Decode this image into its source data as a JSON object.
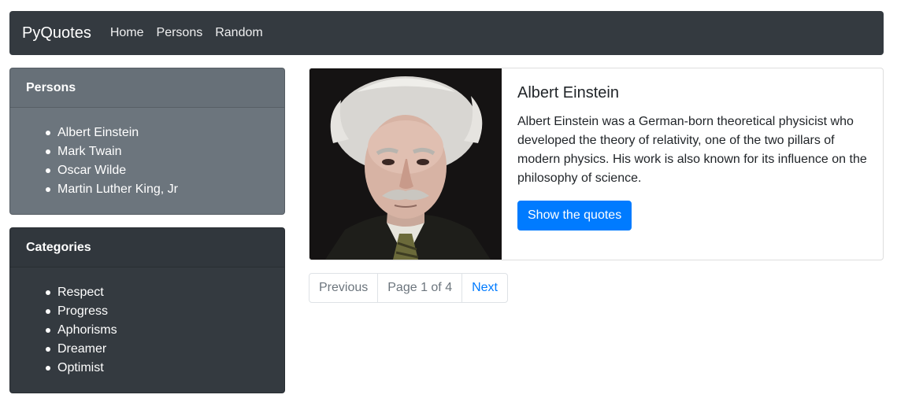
{
  "navbar": {
    "brand": "PyQuotes",
    "links": [
      "Home",
      "Persons",
      "Random"
    ]
  },
  "sidebar": {
    "persons": {
      "title": "Persons",
      "items": [
        "Albert Einstein",
        "Mark Twain",
        "Oscar Wilde",
        "Martin Luther King, Jr"
      ]
    },
    "categories": {
      "title": "Categories",
      "items": [
        "Respect",
        "Progress",
        "Aphorisms",
        "Dreamer",
        "Optimist"
      ]
    }
  },
  "person": {
    "name": "Albert Einstein",
    "description": "Albert Einstein was a German-born theoretical physicist who developed the theory of relativity, one of the two pillars of modern physics. His work is also known for its influence on the philosophy of science.",
    "button_label": "Show the quotes",
    "portrait_icon": "person-portrait"
  },
  "pagination": {
    "previous": "Previous",
    "info": "Page 1 of 4",
    "next": "Next"
  },
  "colors": {
    "navbar": "#343a40",
    "persons_card": "#6c757d",
    "categories_card": "#343a40",
    "primary": "#007bff"
  }
}
